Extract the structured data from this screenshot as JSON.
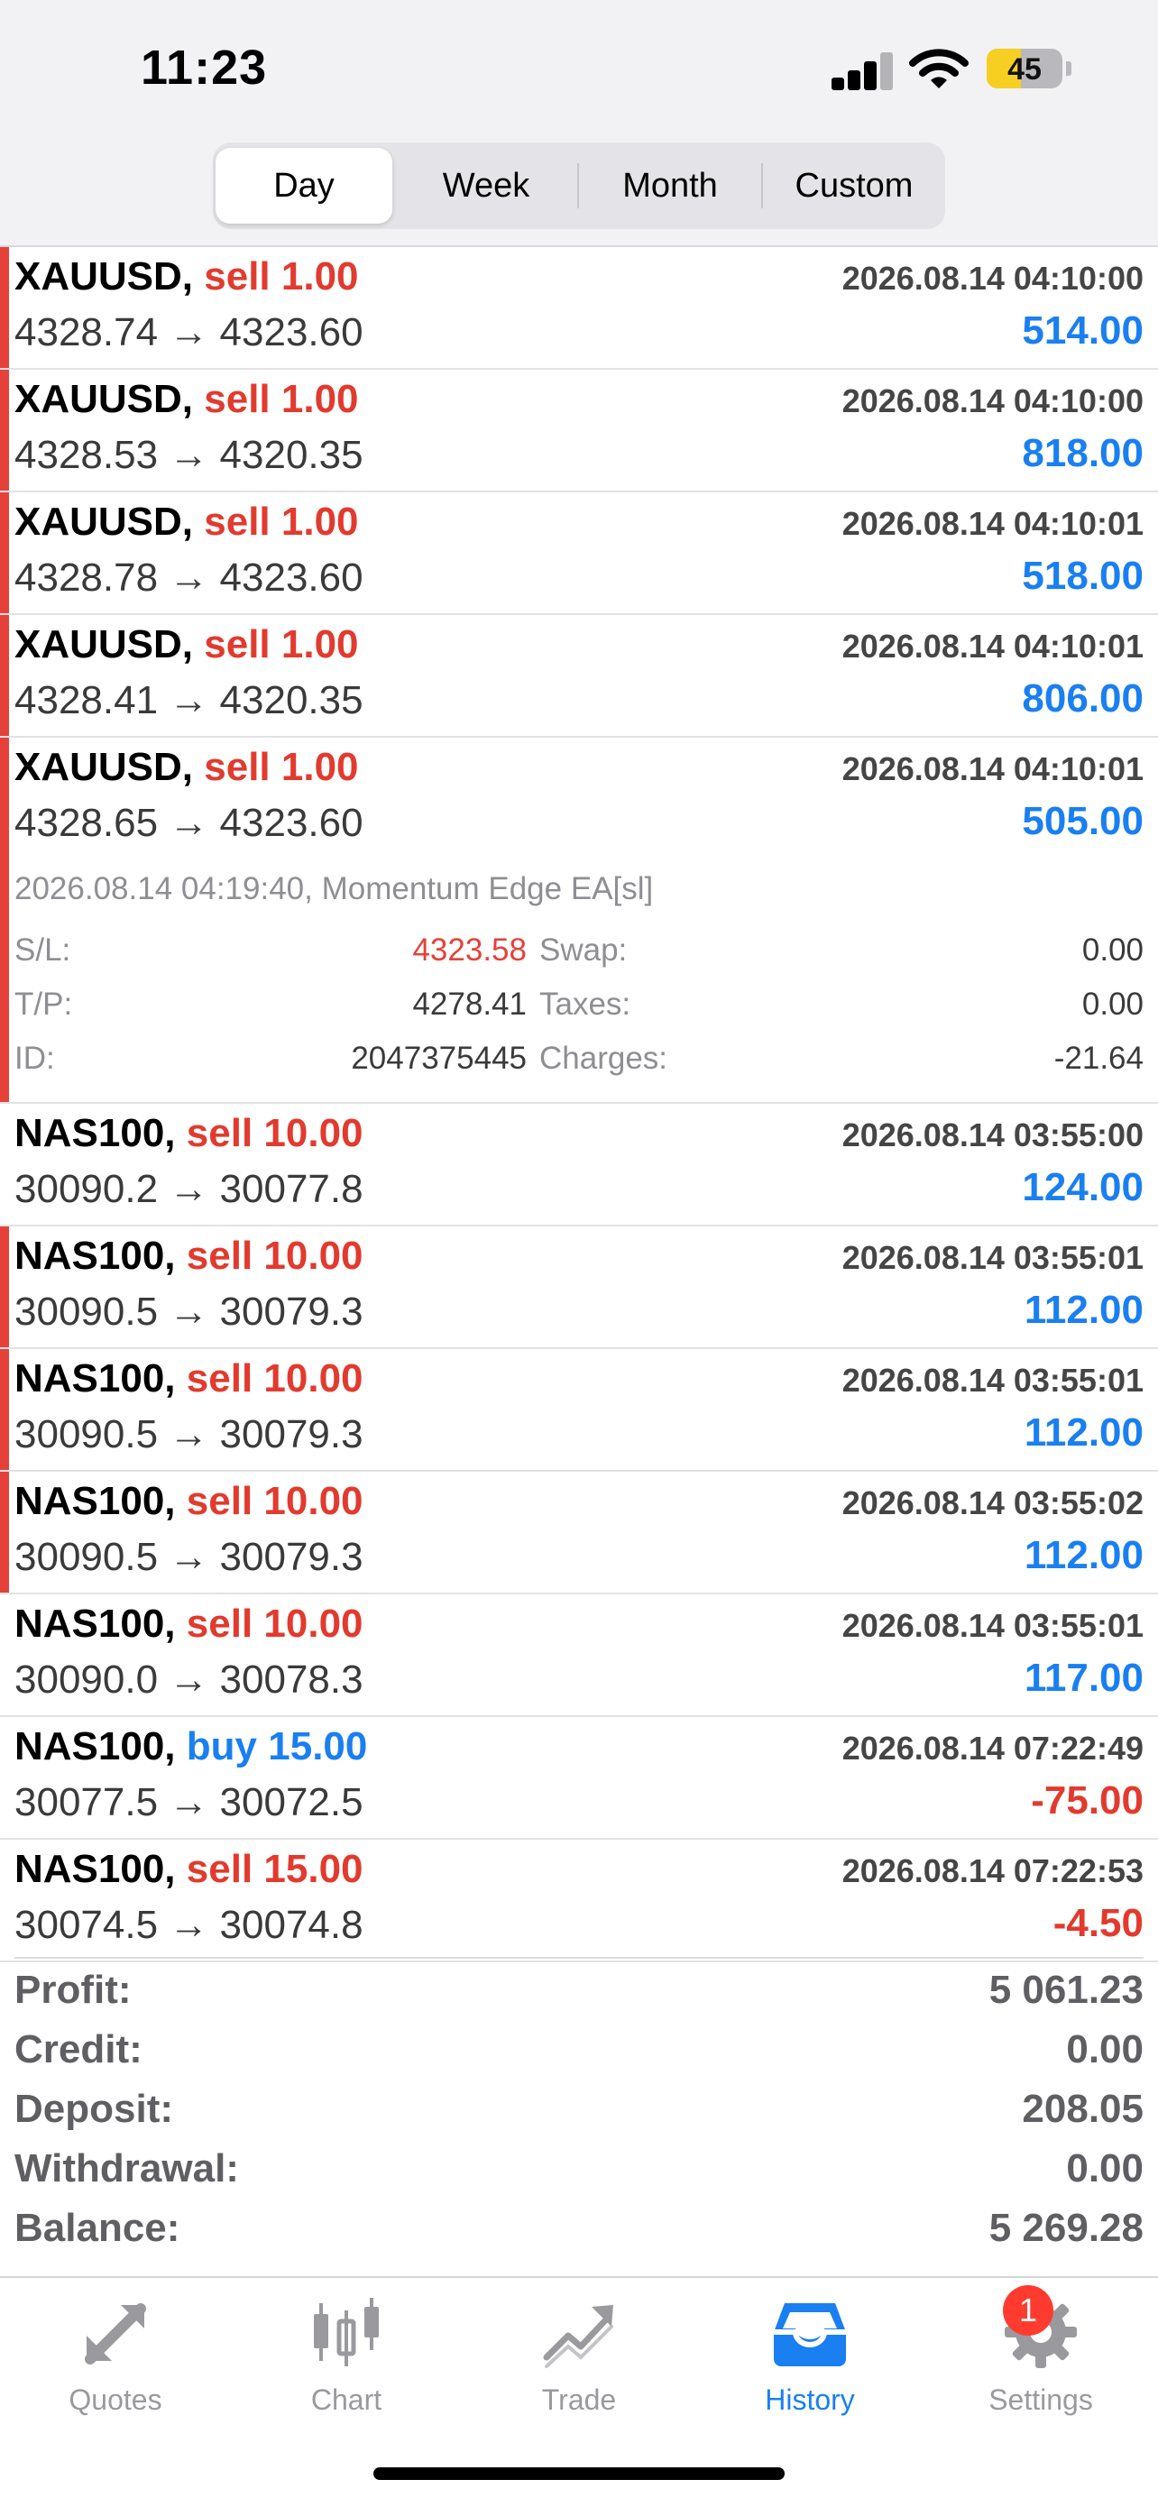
{
  "status_bar": {
    "time": "11:23",
    "battery": "45",
    "battery_level_pct": 45
  },
  "tabs": {
    "items": [
      {
        "label": "Day",
        "active": true
      },
      {
        "label": "Week",
        "active": false
      },
      {
        "label": "Month",
        "active": false
      },
      {
        "label": "Custom",
        "active": false
      }
    ]
  },
  "deals": [
    {
      "symbol": "XAUUSD,",
      "side": "sell",
      "volume": "1.00",
      "time": "2026.08.14 04:10:00",
      "price_open": "4328.74",
      "price_close": "4323.60",
      "profit": "514.00",
      "marked": true
    },
    {
      "symbol": "XAUUSD,",
      "side": "sell",
      "volume": "1.00",
      "time": "2026.08.14 04:10:00",
      "price_open": "4328.53",
      "price_close": "4320.35",
      "profit": "818.00",
      "marked": true
    },
    {
      "symbol": "XAUUSD,",
      "side": "sell",
      "volume": "1.00",
      "time": "2026.08.14 04:10:01",
      "price_open": "4328.78",
      "price_close": "4323.60",
      "profit": "518.00",
      "marked": true
    },
    {
      "symbol": "XAUUSD,",
      "side": "sell",
      "volume": "1.00",
      "time": "2026.08.14 04:10:01",
      "price_open": "4328.41",
      "price_close": "4320.35",
      "profit": "806.00",
      "marked": true
    },
    {
      "symbol": "XAUUSD,",
      "side": "sell",
      "volume": "1.00",
      "time": "2026.08.14 04:10:01",
      "price_open": "4328.65",
      "price_close": "4323.60",
      "profit": "505.00",
      "marked": true
    },
    {
      "symbol": "NAS100,",
      "side": "sell",
      "volume": "10.00",
      "time": "2026.08.14 03:55:00",
      "price_open": "30090.2",
      "price_close": "30077.8",
      "profit": "124.00",
      "marked": false
    },
    {
      "symbol": "NAS100,",
      "side": "sell",
      "volume": "10.00",
      "time": "2026.08.14 03:55:01",
      "price_open": "30090.5",
      "price_close": "30079.3",
      "profit": "112.00",
      "marked": true
    },
    {
      "symbol": "NAS100,",
      "side": "sell",
      "volume": "10.00",
      "time": "2026.08.14 03:55:01",
      "price_open": "30090.5",
      "price_close": "30079.3",
      "profit": "112.00",
      "marked": true
    },
    {
      "symbol": "NAS100,",
      "side": "sell",
      "volume": "10.00",
      "time": "2026.08.14 03:55:02",
      "price_open": "30090.5",
      "price_close": "30079.3",
      "profit": "112.00",
      "marked": true
    },
    {
      "symbol": "NAS100,",
      "side": "sell",
      "volume": "10.00",
      "time": "2026.08.14 03:55:01",
      "price_open": "30090.0",
      "price_close": "30078.3",
      "profit": "117.00",
      "marked": false
    },
    {
      "symbol": "NAS100,",
      "side": "buy",
      "volume": "15.00",
      "time": "2026.08.14 07:22:49",
      "price_open": "30077.5",
      "price_close": "30072.5",
      "profit": "-75.00",
      "marked": false
    },
    {
      "symbol": "NAS100,",
      "side": "sell",
      "volume": "15.00",
      "time": "2026.08.14 07:22:53",
      "price_open": "30074.5",
      "price_close": "30074.8",
      "profit": "-4.50",
      "marked": false
    }
  ],
  "arrow": "→",
  "expanded_detail": {
    "header": "2026.08.14 04:19:40, Momentum Edge EA[sl]",
    "sl_label": "S/L:",
    "sl_value": "4323.58",
    "tp_label": "T/P:",
    "tp_value": "4278.41",
    "id_label": "ID:",
    "id_value": "2047375445",
    "swap_label": "Swap:",
    "swap_value": "0.00",
    "taxes_label": "Taxes:",
    "taxes_value": "0.00",
    "charges_label": "Charges:",
    "charges_value": "-21.64"
  },
  "summary": [
    {
      "label": "Profit:",
      "value": "5 061.23"
    },
    {
      "label": "Credit:",
      "value": "0.00"
    },
    {
      "label": "Deposit:",
      "value": "208.05"
    },
    {
      "label": "Withdrawal:",
      "value": "0.00"
    },
    {
      "label": "Balance:",
      "value": "5 269.28"
    }
  ],
  "tabbar": {
    "items": [
      {
        "label": "Quotes",
        "icon": "quotes-arrows-icon",
        "active": false
      },
      {
        "label": "Chart",
        "icon": "candlestick-chart-icon",
        "active": false
      },
      {
        "label": "Trade",
        "icon": "trend-line-icon",
        "active": false
      },
      {
        "label": "History",
        "icon": "inbox-tray-icon",
        "active": true
      },
      {
        "label": "Settings",
        "icon": "gear-icon",
        "active": false,
        "badge": "1"
      }
    ]
  },
  "colors": {
    "sell": "#e23a2e",
    "buy": "#1a7ff0",
    "accent": "#1a7ff0",
    "marker": "#e5413a"
  }
}
